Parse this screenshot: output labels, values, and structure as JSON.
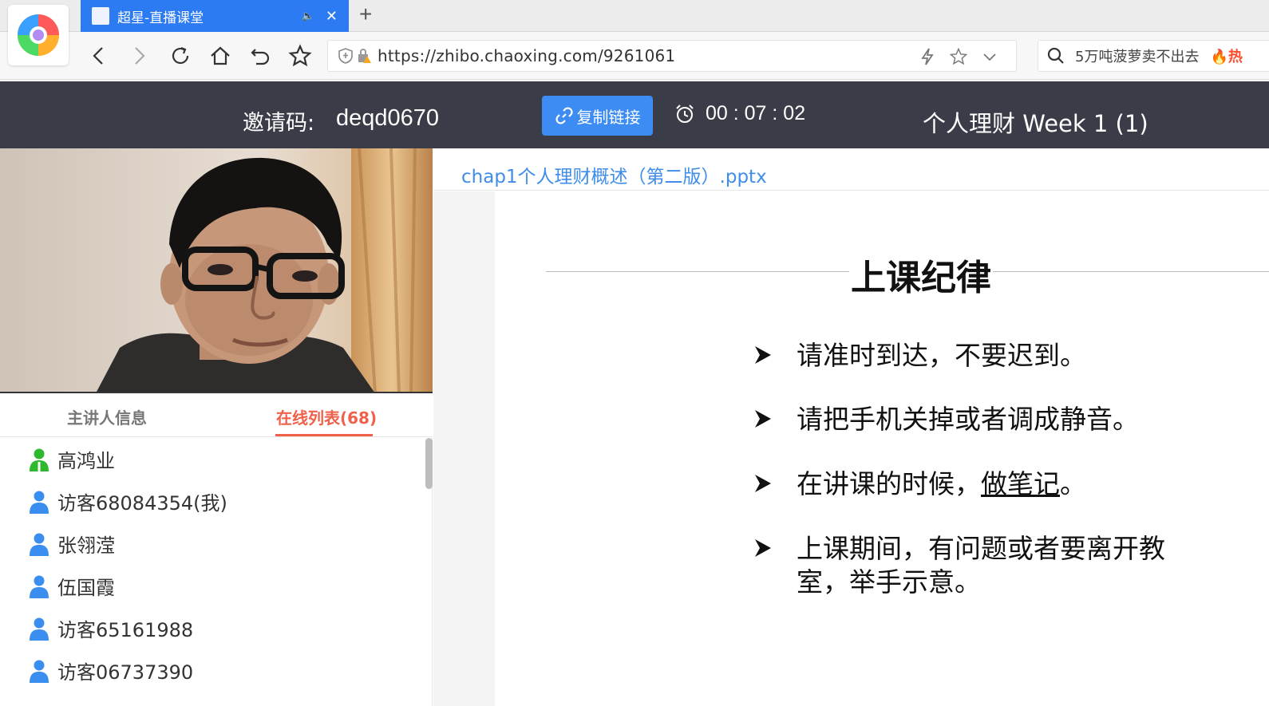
{
  "browser": {
    "tab_title": "超星-直播课堂",
    "new_tab_label": "+",
    "url": "https://zhibo.chaoxing.com/9261061",
    "search_query": "5万吨菠萝卖不出去",
    "search_badge": "热"
  },
  "header": {
    "invite_label": "邀请码:",
    "invite_code": "deqd0670",
    "copy_button": "复制链接",
    "timer": "00 : 07 : 02",
    "course_title": "个人理财 Week 1 (1)"
  },
  "panel": {
    "tabs": [
      {
        "label": "主讲人信息"
      },
      {
        "label": "在线列表(68)"
      }
    ],
    "users": [
      {
        "name": "高鸿业",
        "role": "host",
        "color": "#2eb82e"
      },
      {
        "name": "访客68084354(我)",
        "role": "guest",
        "color": "#3a8ef0"
      },
      {
        "name": "张翎滢",
        "role": "guest",
        "color": "#3a8ef0"
      },
      {
        "name": "伍国霞",
        "role": "guest",
        "color": "#3a8ef0"
      },
      {
        "name": "访客65161988",
        "role": "guest",
        "color": "#3a8ef0"
      },
      {
        "name": "访客06737390",
        "role": "guest",
        "color": "#3a8ef0"
      }
    ]
  },
  "file": {
    "name": "chap1个人理财概述（第二版）.pptx"
  },
  "slide": {
    "title": "上课纪律",
    "bullets": [
      {
        "text": "请准时到达，不要迟到。"
      },
      {
        "text": "请把手机关掉或者调成静音。"
      },
      {
        "text_before": "在讲课的时候，",
        "text_underlined": "做笔记",
        "text_after": "。"
      },
      {
        "text": "上课期间，有问题或者要离开教室，举手示意。"
      }
    ]
  }
}
